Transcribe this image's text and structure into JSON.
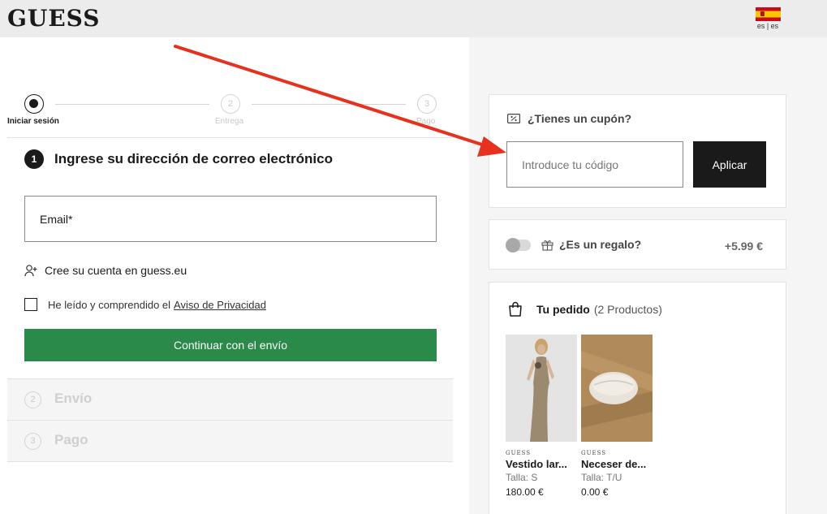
{
  "header": {
    "logo": "GUESS",
    "lang_label": "es | es"
  },
  "stepper": {
    "steps": [
      {
        "num": "",
        "label": "Iniciar sesión"
      },
      {
        "num": "2",
        "label": "Entrega"
      },
      {
        "num": "3",
        "label": "Pago"
      }
    ]
  },
  "email_section": {
    "num": "1",
    "title": "Ingrese su dirección de correo electrónico",
    "email_placeholder": "Email*",
    "create_account": "Cree su cuenta en guess.eu",
    "privacy_prefix": "He leído y comprendido el",
    "privacy_link": "Aviso de Privacidad",
    "continue_label": "Continuar con el envío"
  },
  "collapsed_steps": [
    {
      "num": "2",
      "label": "Envío"
    },
    {
      "num": "3",
      "label": "Pago"
    }
  ],
  "coupon": {
    "title": "¿Tienes un cupón?",
    "placeholder": "Introduce tu código",
    "apply_label": "Aplicar"
  },
  "gift": {
    "label": "¿Es un regalo?",
    "price": "+5.99 €"
  },
  "order": {
    "title": "Tu pedido",
    "count": "(2 Productos)",
    "products": [
      {
        "brand": "GUESS",
        "name": "Vestido lar...",
        "size": "Talla: S",
        "price": "180.00 €"
      },
      {
        "brand": "GUESS",
        "name": "Neceser de...",
        "size": "Talla: T/U",
        "price": "0.00 €"
      }
    ]
  },
  "colors": {
    "primary_green": "#2a8a4a",
    "dark": "#1a1a1a",
    "annotation_arrow": "#e8311d"
  }
}
